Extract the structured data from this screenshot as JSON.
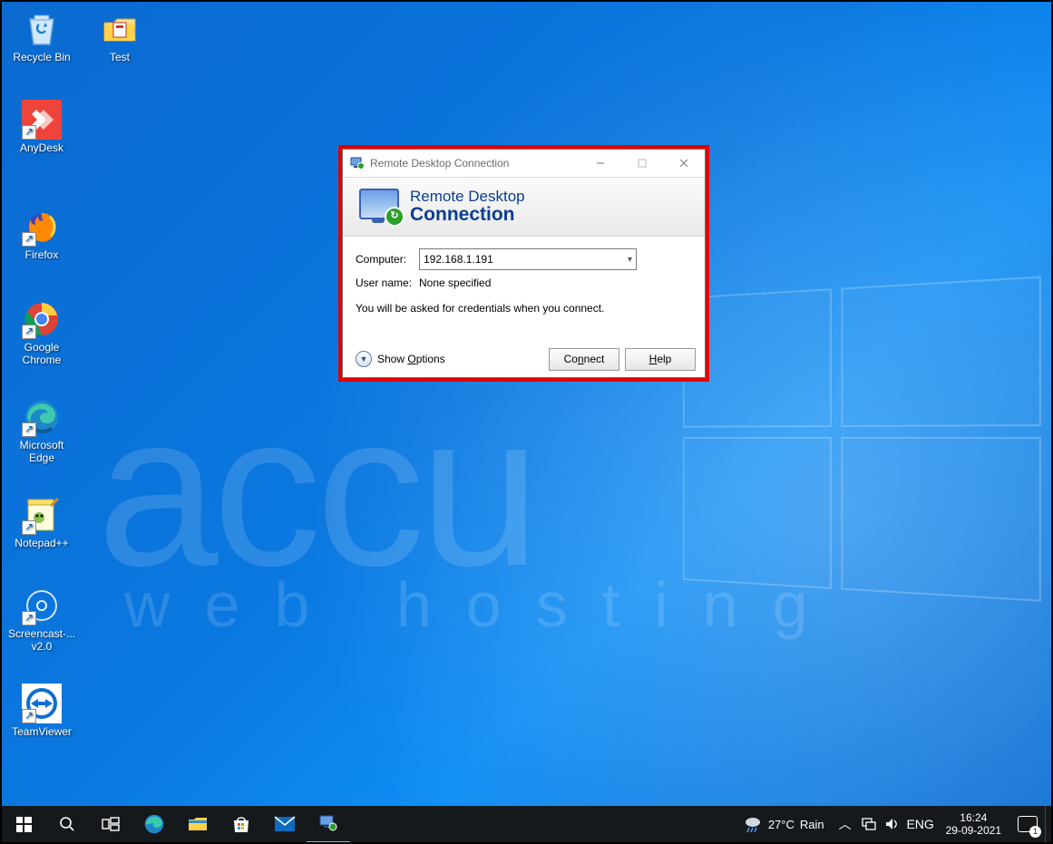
{
  "desktop_icons": [
    {
      "label": "Recycle Bin",
      "shortcut": false
    },
    {
      "label": "Test",
      "shortcut": false
    },
    {
      "label": "AnyDesk",
      "shortcut": true
    },
    {
      "label": "Firefox",
      "shortcut": true
    },
    {
      "label": "Google Chrome",
      "shortcut": true
    },
    {
      "label": "Microsoft Edge",
      "shortcut": true
    },
    {
      "label": "Notepad++",
      "shortcut": true
    },
    {
      "label": "Screencast-... v2.0",
      "shortcut": true
    },
    {
      "label": "TeamViewer",
      "shortcut": true
    }
  ],
  "rdc": {
    "window_title": "Remote Desktop Connection",
    "banner_line1": "Remote Desktop",
    "banner_line2": "Connection",
    "computer_label": "Computer:",
    "computer_value": "192.168.1.191",
    "username_label": "User name:",
    "username_value": "None specified",
    "hint": "You will be asked for credentials when you connect.",
    "show_options_pre": "Show ",
    "show_options_key": "O",
    "show_options_post": "ptions",
    "connect_pre": "Co",
    "connect_key": "n",
    "connect_post": "nect",
    "help_pre": "",
    "help_key": "H",
    "help_post": "elp"
  },
  "taskbar": {
    "weather_temp": "27°C",
    "weather_text": "Rain",
    "lang": "ENG",
    "time": "16:24",
    "date": "29-09-2021",
    "notif_count": "1"
  },
  "watermark": {
    "top": "accu",
    "bottom": "web hosting"
  }
}
